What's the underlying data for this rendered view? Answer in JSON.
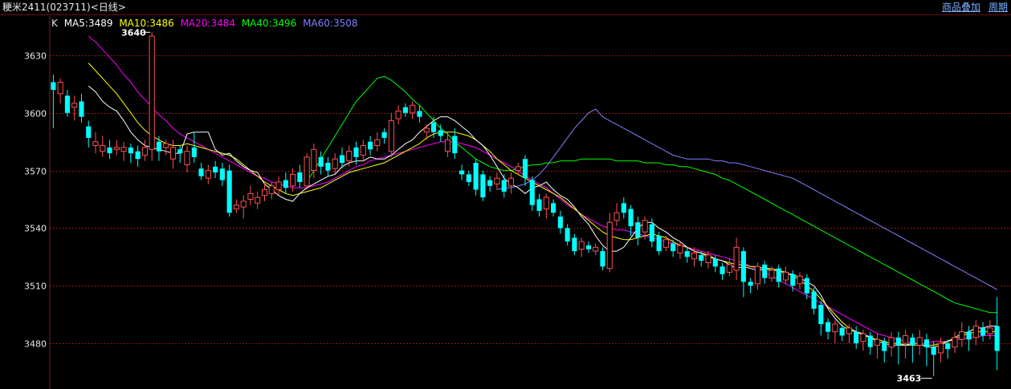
{
  "header": {
    "title": "粳米2411(023711)<日线>",
    "link1": "商品叠加",
    "link2": "周期"
  },
  "legend": {
    "k": "K",
    "ma5": "MA5:3489",
    "ma10": "MA10:3486",
    "ma20": "MA20:3484",
    "ma40": "MA40:3496",
    "ma60": "MA60:3508"
  },
  "colors": {
    "up": "#ff5050",
    "down": "#00ffff",
    "grid": "#8a1a1a",
    "ma5": "#ffffff",
    "ma10": "#ffff00",
    "ma20": "#ff00ff",
    "ma40": "#00ff00",
    "ma60": "#8080ff"
  },
  "chart_data": {
    "type": "candlestick",
    "y_ticks": [
      3630,
      3600,
      3570,
      3540,
      3510,
      3480
    ],
    "ylim": [
      3460,
      3643
    ],
    "annotations": {
      "max": "3640",
      "min": "3463"
    },
    "candles": [
      [
        3616,
        3612,
        3620,
        3592
      ],
      [
        3610,
        3616,
        3618,
        3605
      ],
      [
        3609,
        3600,
        3612,
        3598
      ],
      [
        3603,
        3605,
        3609,
        3596
      ],
      [
        3606,
        3598,
        3610,
        3595
      ],
      [
        3593,
        3587,
        3596,
        3582
      ],
      [
        3583,
        3585,
        3590,
        3579
      ],
      [
        3580,
        3583,
        3588,
        3577
      ],
      [
        3582,
        3579,
        3586,
        3576
      ],
      [
        3581,
        3582,
        3586,
        3578
      ],
      [
        3580,
        3582,
        3585,
        3575
      ],
      [
        3582,
        3579,
        3584,
        3574
      ],
      [
        3580,
        3576,
        3583,
        3572
      ],
      [
        3578,
        3582,
        3586,
        3575
      ],
      [
        3581,
        3640,
        3642,
        3575
      ],
      [
        3585,
        3580,
        3588,
        3575
      ],
      [
        3582,
        3584,
        3586,
        3578
      ],
      [
        3576,
        3582,
        3586,
        3571
      ],
      [
        3581,
        3579,
        3583,
        3574
      ],
      [
        3573,
        3580,
        3583,
        3569
      ],
      [
        3582,
        3577,
        3590,
        3574
      ],
      [
        3571,
        3567,
        3574,
        3565
      ],
      [
        3566,
        3570,
        3573,
        3563
      ],
      [
        3572,
        3569,
        3575,
        3566
      ],
      [
        3571,
        3565,
        3574,
        3562
      ],
      [
        3570,
        3548,
        3573,
        3546
      ],
      [
        3550,
        3552,
        3555,
        3548
      ],
      [
        3551,
        3554,
        3557,
        3545
      ],
      [
        3555,
        3558,
        3562,
        3552
      ],
      [
        3553,
        3556,
        3559,
        3550
      ],
      [
        3557,
        3560,
        3563,
        3554
      ],
      [
        3558,
        3562,
        3564,
        3555
      ],
      [
        3560,
        3564,
        3567,
        3557
      ],
      [
        3565,
        3561,
        3569,
        3558
      ],
      [
        3562,
        3568,
        3571,
        3559
      ],
      [
        3569,
        3564,
        3573,
        3561
      ],
      [
        3562,
        3577,
        3579,
        3560
      ],
      [
        3570,
        3581,
        3584,
        3566
      ],
      [
        3577,
        3572,
        3580,
        3568
      ],
      [
        3574,
        3570,
        3577,
        3567
      ],
      [
        3571,
        3576,
        3579,
        3568
      ],
      [
        3578,
        3574,
        3582,
        3571
      ],
      [
        3575,
        3580,
        3583,
        3572
      ],
      [
        3582,
        3577,
        3585,
        3573
      ],
      [
        3578,
        3583,
        3586,
        3575
      ],
      [
        3585,
        3581,
        3588,
        3578
      ],
      [
        3583,
        3586,
        3590,
        3580
      ],
      [
        3590,
        3587,
        3592,
        3584
      ],
      [
        3580,
        3596,
        3600,
        3577
      ],
      [
        3597,
        3601,
        3604,
        3594
      ],
      [
        3603,
        3600,
        3605,
        3598
      ],
      [
        3600,
        3604,
        3606,
        3597
      ],
      [
        3601,
        3598,
        3604,
        3595
      ],
      [
        3590,
        3592,
        3594,
        3586
      ],
      [
        3595,
        3590,
        3598,
        3587
      ],
      [
        3591,
        3588,
        3594,
        3585
      ],
      [
        3580,
        3586,
        3590,
        3577
      ],
      [
        3588,
        3579,
        3592,
        3576
      ],
      [
        3570,
        3568,
        3573,
        3565
      ],
      [
        3568,
        3564,
        3570,
        3562
      ],
      [
        3574,
        3560,
        3576,
        3557
      ],
      [
        3568,
        3556,
        3570,
        3554
      ],
      [
        3565,
        3562,
        3567,
        3559
      ],
      [
        3563,
        3566,
        3569,
        3560
      ],
      [
        3565,
        3559,
        3568,
        3556
      ],
      [
        3562,
        3566,
        3569,
        3558
      ],
      [
        3570,
        3572,
        3574,
        3568
      ],
      [
        3576,
        3566,
        3578,
        3562
      ],
      [
        3565,
        3552,
        3567,
        3549
      ],
      [
        3555,
        3549,
        3558,
        3546
      ],
      [
        3550,
        3556,
        3558,
        3545
      ],
      [
        3553,
        3548,
        3555,
        3546
      ],
      [
        3546,
        3540,
        3549,
        3537
      ],
      [
        3540,
        3533,
        3542,
        3531
      ],
      [
        3535,
        3528,
        3537,
        3526
      ],
      [
        3529,
        3533,
        3535,
        3525
      ],
      [
        3531,
        3529,
        3533,
        3527
      ],
      [
        3528,
        3530,
        3532,
        3526
      ],
      [
        3528,
        3520,
        3530,
        3518
      ],
      [
        3519,
        3543,
        3548,
        3517
      ],
      [
        3544,
        3548,
        3553,
        3541
      ],
      [
        3553,
        3548,
        3556,
        3545
      ],
      [
        3550,
        3541,
        3552,
        3536
      ],
      [
        3543,
        3535,
        3546,
        3531
      ],
      [
        3538,
        3544,
        3546,
        3534
      ],
      [
        3542,
        3533,
        3545,
        3530
      ],
      [
        3536,
        3528,
        3538,
        3526
      ],
      [
        3530,
        3534,
        3536,
        3528
      ],
      [
        3532,
        3528,
        3534,
        3525
      ],
      [
        3527,
        3531,
        3533,
        3524
      ],
      [
        3528,
        3525,
        3530,
        3522
      ],
      [
        3524,
        3527,
        3530,
        3520
      ],
      [
        3526,
        3523,
        3528,
        3520
      ],
      [
        3522,
        3526,
        3528,
        3519
      ],
      [
        3524,
        3520,
        3526,
        3517
      ],
      [
        3520,
        3516,
        3522,
        3513
      ],
      [
        3517,
        3521,
        3524,
        3515
      ],
      [
        3518,
        3530,
        3535,
        3513
      ],
      [
        3528,
        3512,
        3530,
        3504
      ],
      [
        3512,
        3510,
        3514,
        3506
      ],
      [
        3511,
        3520,
        3522,
        3508
      ],
      [
        3521,
        3514,
        3523,
        3511
      ],
      [
        3514,
        3518,
        3520,
        3512
      ],
      [
        3519,
        3512,
        3521,
        3509
      ],
      [
        3513,
        3517,
        3520,
        3511
      ],
      [
        3516,
        3510,
        3518,
        3507
      ],
      [
        3511,
        3515,
        3517,
        3508
      ],
      [
        3514,
        3506,
        3516,
        3503
      ],
      [
        3507,
        3498,
        3509,
        3495
      ],
      [
        3500,
        3490,
        3502,
        3484
      ],
      [
        3491,
        3486,
        3493,
        3482
      ],
      [
        3486,
        3490,
        3492,
        3480
      ],
      [
        3488,
        3484,
        3490,
        3481
      ],
      [
        3485,
        3488,
        3490,
        3480
      ],
      [
        3486,
        3480,
        3489,
        3477
      ],
      [
        3481,
        3485,
        3487,
        3476
      ],
      [
        3484,
        3478,
        3486,
        3474
      ],
      [
        3479,
        3482,
        3485,
        3472
      ],
      [
        3481,
        3476,
        3483,
        3470
      ],
      [
        3478,
        3483,
        3486,
        3473
      ],
      [
        3483,
        3479,
        3486,
        3469
      ],
      [
        3480,
        3484,
        3487,
        3472
      ],
      [
        3483,
        3479,
        3485,
        3470
      ],
      [
        3479,
        3483,
        3487,
        3474
      ],
      [
        3482,
        3478,
        3485,
        3468
      ],
      [
        3478,
        3474,
        3481,
        3463
      ],
      [
        3475,
        3480,
        3483,
        3470
      ],
      [
        3480,
        3477,
        3482,
        3472
      ],
      [
        3478,
        3483,
        3486,
        3475
      ],
      [
        3482,
        3486,
        3491,
        3478
      ],
      [
        3486,
        3482,
        3489,
        3476
      ],
      [
        3483,
        3489,
        3492,
        3479
      ],
      [
        3488,
        3484,
        3491,
        3481
      ],
      [
        3485,
        3488,
        3492,
        3482
      ],
      [
        3489,
        3476,
        3504,
        3466
      ]
    ],
    "ma5": [
      3614,
      3611,
      3606,
      3603,
      3601,
      3596,
      3590,
      3586,
      3583,
      3582,
      3581,
      3580,
      3579,
      3579,
      3589,
      3590,
      3590,
      3590,
      3581,
      3578,
      3579,
      3575,
      3572,
      3570,
      3569,
      3563,
      3560,
      3557,
      3555,
      3554,
      3558,
      3561,
      3563,
      3565,
      3567,
      3568,
      3572,
      3574,
      3575,
      3575,
      3577,
      3576,
      3576,
      3578,
      3581,
      3584,
      3586,
      3590,
      3593,
      3596,
      3598,
      3598,
      3596,
      3593,
      3590,
      3586,
      3583,
      3578,
      3572,
      3566,
      3563,
      3561,
      3558,
      3561,
      3562,
      3564,
      3560,
      3557,
      3555,
      3551,
      3546,
      3542,
      3536,
      3531,
      3528,
      3528,
      3530,
      3535,
      3540,
      3543,
      3543,
      3540,
      3538,
      3535,
      3533,
      3530,
      3528,
      3527,
      3525,
      3524,
      3523,
      3521,
      3519,
      3520,
      3519,
      3518,
      3519,
      3518,
      3518,
      3516,
      3516,
      3514,
      3512,
      3510,
      3505,
      3498,
      3493,
      3489,
      3487,
      3486,
      3485,
      3483,
      3481,
      3480,
      3479,
      3479,
      3479,
      3480,
      3480,
      3478,
      3478,
      3479,
      3481,
      3483,
      3485,
      3486,
      3488,
      3488,
      3489,
      3489
    ],
    "ma10": [
      3626,
      3622,
      3618,
      3614,
      3610,
      3605,
      3600,
      3595,
      3591,
      3588,
      3586,
      3584,
      3583,
      3583,
      3584,
      3583,
      3582,
      3581,
      3580,
      3579,
      3578,
      3576,
      3573,
      3570,
      3567,
      3564,
      3562,
      3560,
      3558,
      3557,
      3558,
      3559,
      3560,
      3561,
      3563,
      3565,
      3567,
      3569,
      3570,
      3571,
      3572,
      3573,
      3574,
      3576,
      3578,
      3580,
      3582,
      3584,
      3587,
      3589,
      3590,
      3590,
      3590,
      3589,
      3588,
      3586,
      3583,
      3580,
      3576,
      3573,
      3570,
      3568,
      3566,
      3564,
      3562,
      3560,
      3558,
      3556,
      3553,
      3550,
      3547,
      3544,
      3541,
      3538,
      3536,
      3535,
      3534,
      3534,
      3535,
      3536,
      3537,
      3536,
      3535,
      3533,
      3531,
      3530,
      3528,
      3527,
      3526,
      3524,
      3523,
      3522,
      3521,
      3521,
      3520,
      3520,
      3519,
      3519,
      3518,
      3517,
      3515,
      3513,
      3510,
      3507,
      3503,
      3499,
      3495,
      3491,
      3488,
      3486,
      3484,
      3483,
      3482,
      3481,
      3480,
      3480,
      3479,
      3479,
      3479,
      3479,
      3479,
      3480,
      3481,
      3482,
      3484,
      3485,
      3486,
      3486,
      3486,
      3486
    ],
    "ma20": [
      3640,
      3637,
      3633,
      3629,
      3625,
      3620,
      3616,
      3611,
      3607,
      3603,
      3599,
      3596,
      3592,
      3589,
      3587,
      3585,
      3583,
      3581,
      3579,
      3577,
      3575,
      3573,
      3571,
      3569,
      3567,
      3566,
      3564,
      3563,
      3562,
      3561,
      3561,
      3561,
      3562,
      3563,
      3564,
      3566,
      3568,
      3570,
      3572,
      3573,
      3575,
      3576,
      3577,
      3578,
      3579,
      3580,
      3581,
      3582,
      3583,
      3584,
      3585,
      3585,
      3585,
      3584,
      3583,
      3582,
      3580,
      3578,
      3576,
      3574,
      3572,
      3570,
      3567,
      3565,
      3563,
      3561,
      3558,
      3555,
      3552,
      3550,
      3547,
      3545,
      3543,
      3541,
      3540,
      3539,
      3539,
      3538,
      3537,
      3536,
      3535,
      3534,
      3533,
      3532,
      3531,
      3530,
      3529,
      3528,
      3527,
      3526,
      3525,
      3524,
      3523,
      3522,
      3520,
      3519,
      3517,
      3515,
      3513,
      3511,
      3509,
      3507,
      3505,
      3503,
      3501,
      3499,
      3497,
      3495,
      3493,
      3491,
      3489,
      3487,
      3485,
      3484,
      3483,
      3482,
      3481,
      3480,
      3480,
      3480,
      3481,
      3481,
      3481,
      3482,
      3482,
      3483,
      3483,
      3484,
      3484,
      3484
    ],
    "ma40": [
      3564,
      3570,
      3576,
      3582,
      3588,
      3594,
      3600,
      3606,
      3610,
      3614,
      3618,
      3619,
      3617,
      3614,
      3611,
      3607,
      3604,
      3600,
      3596,
      3592,
      3589,
      3585,
      3582,
      3579,
      3576,
      3574,
      3572,
      3571,
      3570,
      3570,
      3571,
      3572,
      3573,
      3573,
      3574,
      3574,
      3575,
      3575,
      3575,
      3576,
      3576,
      3576,
      3576,
      3576,
      3575,
      3575,
      3575,
      3575,
      3574,
      3574,
      3574,
      3573,
      3573,
      3572,
      3572,
      3571,
      3570,
      3569,
      3568,
      3566,
      3565,
      3563,
      3561,
      3559,
      3557,
      3555,
      3553,
      3551,
      3549,
      3547,
      3545,
      3543,
      3541,
      3539,
      3537,
      3535,
      3533,
      3531,
      3529,
      3527,
      3525,
      3523,
      3521,
      3519,
      3517,
      3515,
      3513,
      3511,
      3509,
      3507,
      3505,
      3503,
      3501,
      3500,
      3499,
      3498,
      3497,
      3496,
      3496
    ],
    "ma60": [
      3560,
      3561,
      3561,
      3562,
      3563,
      3565,
      3568,
      3572,
      3577,
      3582,
      3587,
      3592,
      3596,
      3600,
      3602,
      3598,
      3596,
      3594,
      3592,
      3590,
      3588,
      3586,
      3584,
      3582,
      3580,
      3578,
      3577,
      3576,
      3576,
      3576,
      3576,
      3575,
      3575,
      3574,
      3574,
      3573,
      3572,
      3571,
      3570,
      3569,
      3568,
      3567,
      3566,
      3564,
      3562,
      3560,
      3558,
      3556,
      3554,
      3552,
      3550,
      3548,
      3546,
      3544,
      3542,
      3540,
      3538,
      3536,
      3534,
      3532,
      3530,
      3528,
      3526,
      3524,
      3522,
      3520,
      3518,
      3516,
      3514,
      3512,
      3510,
      3508
    ]
  }
}
